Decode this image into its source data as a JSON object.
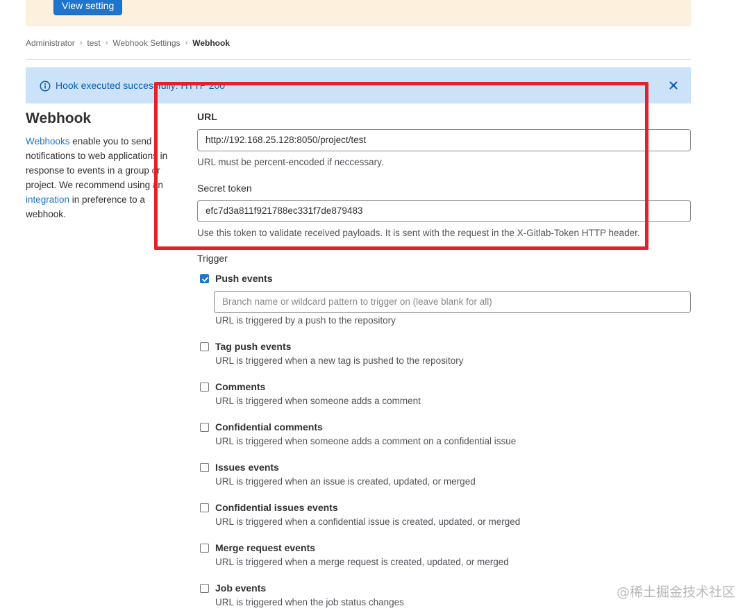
{
  "banner": {
    "button_label": "View setting"
  },
  "breadcrumb": [
    "Administrator",
    "test",
    "Webhook Settings",
    "Webhook"
  ],
  "alert": {
    "message": "Hook executed successfully: HTTP 200"
  },
  "sidebar": {
    "title": "Webhook",
    "desc_link1": "Webhooks",
    "desc_part1": " enable you to send notifications to web applications in response to events in a group or project. We recommend using an ",
    "desc_link2": "integration",
    "desc_part2": " in preference to a webhook."
  },
  "form": {
    "url_label": "URL",
    "url_value": "http://192.168.25.128:8050/project/test",
    "url_help": "URL must be percent-encoded if neccessary.",
    "token_label": "Secret token",
    "token_value": "efc7d3a811f921788ec331f7de879483",
    "token_help": "Use this token to validate received payloads. It is sent with the request in the X-Gitlab-Token HTTP header.",
    "trigger_label": "Trigger",
    "branch_placeholder": "Branch name or wildcard pattern to trigger on (leave blank for all)"
  },
  "triggers": [
    {
      "label": "Push events",
      "help": "URL is triggered by a push to the repository",
      "checked": true
    },
    {
      "label": "Tag push events",
      "help": "URL is triggered when a new tag is pushed to the repository",
      "checked": false
    },
    {
      "label": "Comments",
      "help": "URL is triggered when someone adds a comment",
      "checked": false
    },
    {
      "label": "Confidential comments",
      "help": "URL is triggered when someone adds a comment on a confidential issue",
      "checked": false
    },
    {
      "label": "Issues events",
      "help": "URL is triggered when an issue is created, updated, or merged",
      "checked": false
    },
    {
      "label": "Confidential issues events",
      "help": "URL is triggered when a confidential issue is created, updated, or merged",
      "checked": false
    },
    {
      "label": "Merge request events",
      "help": "URL is triggered when a merge request is created, updated, or merged",
      "checked": false
    },
    {
      "label": "Job events",
      "help": "URL is triggered when the job status changes",
      "checked": false
    }
  ],
  "watermark": "@稀土掘金技术社区",
  "colors": {
    "primary": "#1f75cb",
    "alert_bg": "#cbe2f9",
    "banner_bg": "#fdf1dd",
    "highlight": "#e5202a"
  }
}
